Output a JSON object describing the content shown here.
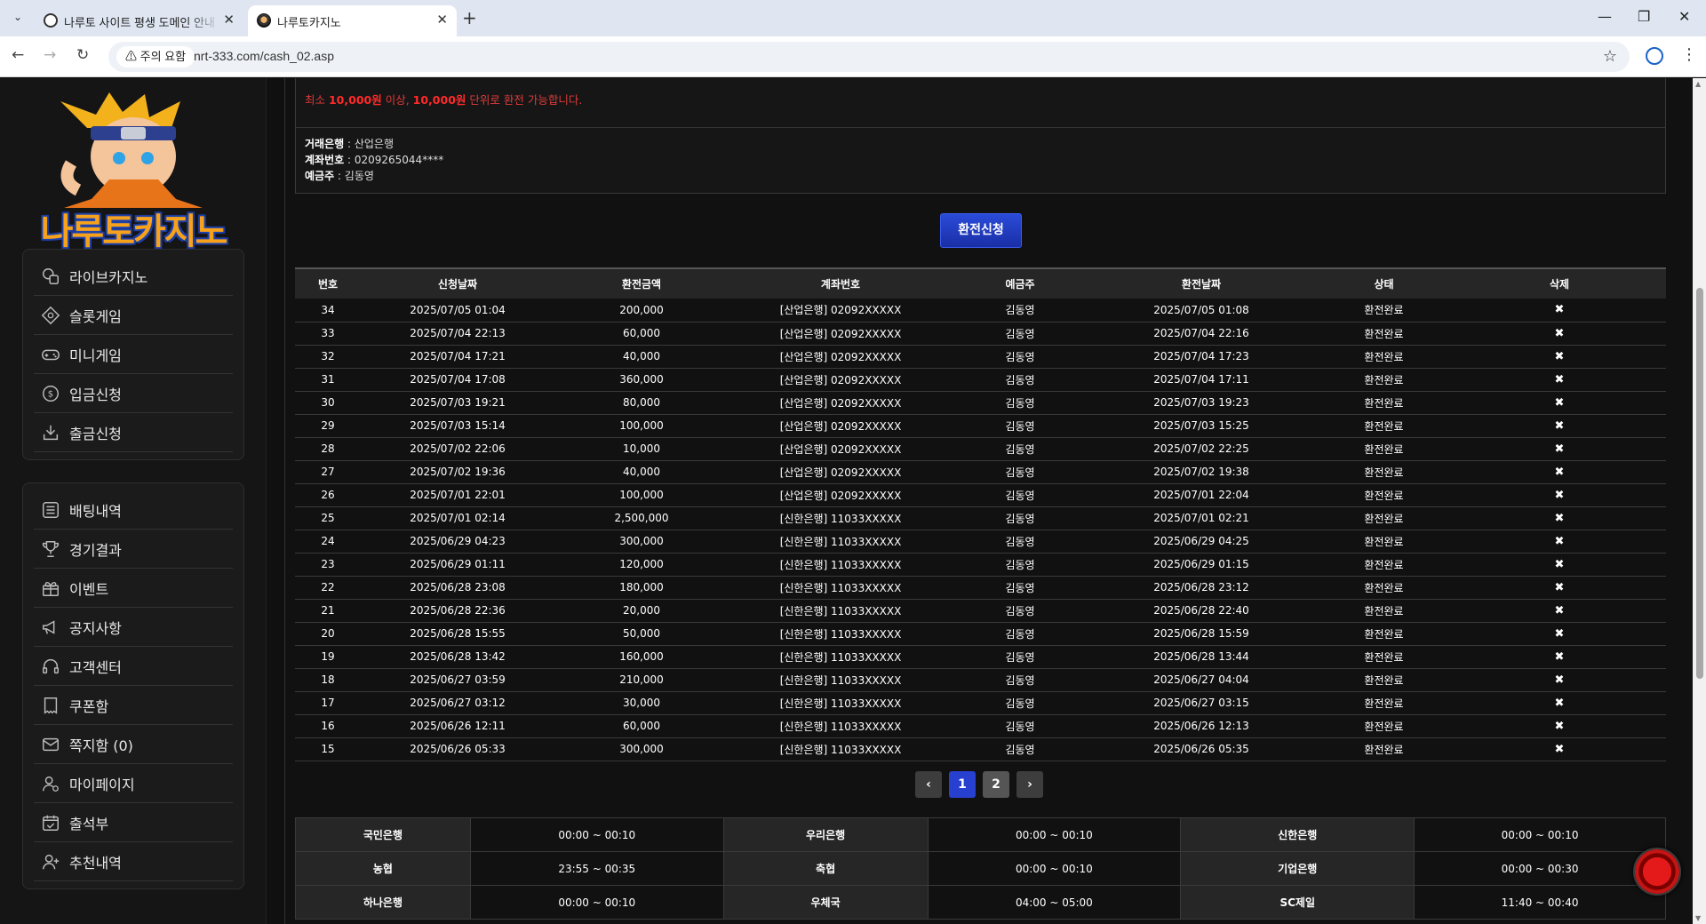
{
  "browser": {
    "tabs": [
      {
        "title": "나루토 사이트 평생 도메인 안내"
      },
      {
        "title": "나루토카지노"
      }
    ],
    "security_chip": "주의 요함",
    "url": "nrt-333.com/cash_02.asp"
  },
  "sidebar": {
    "logo_text": "나루토카지노",
    "menu_primary": [
      {
        "label": "라이브카지노",
        "icon": "casino-chips-icon"
      },
      {
        "label": "슬롯게임",
        "icon": "diamond-icon"
      },
      {
        "label": "미니게임",
        "icon": "gamepad-icon"
      },
      {
        "label": "입금신청",
        "icon": "coin-dollar-icon"
      },
      {
        "label": "출금신청",
        "icon": "download-tray-icon"
      }
    ],
    "menu_secondary": [
      {
        "label": "배팅내역",
        "icon": "list-icon"
      },
      {
        "label": "경기결과",
        "icon": "trophy-icon"
      },
      {
        "label": "이벤트",
        "icon": "gift-icon"
      },
      {
        "label": "공지사항",
        "icon": "megaphone-icon"
      },
      {
        "label": "고객센터",
        "icon": "headset-icon"
      },
      {
        "label": "쿠폰함",
        "icon": "coupon-icon"
      },
      {
        "label": "쪽지함 (0)",
        "icon": "mail-icon"
      },
      {
        "label": "마이페이지",
        "icon": "user-gear-icon"
      },
      {
        "label": "출석부",
        "icon": "calendar-check-icon"
      },
      {
        "label": "추천내역",
        "icon": "user-plus-icon"
      }
    ]
  },
  "notice": {
    "prefix": "최소 ",
    "amount1": "10,000원",
    "middle": " 이상, ",
    "amount2": "10,000원",
    "suffix": "  단위로 환전 가능합니다."
  },
  "account": {
    "bank_label": "거래은행",
    "bank_value": " : 산업은행",
    "number_label": "계좌번호",
    "number_value": " : 0209265044****",
    "holder_label": "예금주",
    "holder_value": " : 김동영"
  },
  "apply_button": "환전신청",
  "history": {
    "headers": [
      "번호",
      "신청날짜",
      "환전금액",
      "계좌번호",
      "예금주",
      "환전날짜",
      "상태",
      "삭제"
    ],
    "delete_symbol": "✖",
    "rows": [
      [
        "34",
        "2025/07/05 01:04",
        "200,000",
        "[산업은행] 02092XXXXX",
        "김동영",
        "2025/07/05 01:08",
        "환전완료"
      ],
      [
        "33",
        "2025/07/04 22:13",
        "60,000",
        "[산업은행] 02092XXXXX",
        "김동영",
        "2025/07/04 22:16",
        "환전완료"
      ],
      [
        "32",
        "2025/07/04 17:21",
        "40,000",
        "[산업은행] 02092XXXXX",
        "김동영",
        "2025/07/04 17:23",
        "환전완료"
      ],
      [
        "31",
        "2025/07/04 17:08",
        "360,000",
        "[산업은행] 02092XXXXX",
        "김동영",
        "2025/07/04 17:11",
        "환전완료"
      ],
      [
        "30",
        "2025/07/03 19:21",
        "80,000",
        "[산업은행] 02092XXXXX",
        "김동영",
        "2025/07/03 19:23",
        "환전완료"
      ],
      [
        "29",
        "2025/07/03 15:14",
        "100,000",
        "[산업은행] 02092XXXXX",
        "김동영",
        "2025/07/03 15:25",
        "환전완료"
      ],
      [
        "28",
        "2025/07/02 22:06",
        "10,000",
        "[산업은행] 02092XXXXX",
        "김동영",
        "2025/07/02 22:25",
        "환전완료"
      ],
      [
        "27",
        "2025/07/02 19:36",
        "40,000",
        "[산업은행] 02092XXXXX",
        "김동영",
        "2025/07/02 19:38",
        "환전완료"
      ],
      [
        "26",
        "2025/07/01 22:01",
        "100,000",
        "[산업은행] 02092XXXXX",
        "김동영",
        "2025/07/01 22:04",
        "환전완료"
      ],
      [
        "25",
        "2025/07/01 02:14",
        "2,500,000",
        "[신한은행] 11033XXXXX",
        "김동영",
        "2025/07/01 02:21",
        "환전완료"
      ],
      [
        "24",
        "2025/06/29 04:23",
        "300,000",
        "[신한은행] 11033XXXXX",
        "김동영",
        "2025/06/29 04:25",
        "환전완료"
      ],
      [
        "23",
        "2025/06/29 01:11",
        "120,000",
        "[신한은행] 11033XXXXX",
        "김동영",
        "2025/06/29 01:15",
        "환전완료"
      ],
      [
        "22",
        "2025/06/28 23:08",
        "180,000",
        "[신한은행] 11033XXXXX",
        "김동영",
        "2025/06/28 23:12",
        "환전완료"
      ],
      [
        "21",
        "2025/06/28 22:36",
        "20,000",
        "[신한은행] 11033XXXXX",
        "김동영",
        "2025/06/28 22:40",
        "환전완료"
      ],
      [
        "20",
        "2025/06/28 15:55",
        "50,000",
        "[신한은행] 11033XXXXX",
        "김동영",
        "2025/06/28 15:59",
        "환전완료"
      ],
      [
        "19",
        "2025/06/28 13:42",
        "160,000",
        "[신한은행] 11033XXXXX",
        "김동영",
        "2025/06/28 13:44",
        "환전완료"
      ],
      [
        "18",
        "2025/06/27 03:59",
        "210,000",
        "[신한은행] 11033XXXXX",
        "김동영",
        "2025/06/27 04:04",
        "환전완료"
      ],
      [
        "17",
        "2025/06/27 03:12",
        "30,000",
        "[신한은행] 11033XXXXX",
        "김동영",
        "2025/06/27 03:15",
        "환전완료"
      ],
      [
        "16",
        "2025/06/26 12:11",
        "60,000",
        "[신한은행] 11033XXXXX",
        "김동영",
        "2025/06/26 12:13",
        "환전완료"
      ],
      [
        "15",
        "2025/06/26 05:33",
        "300,000",
        "[신한은행] 11033XXXXX",
        "김동영",
        "2025/06/26 05:35",
        "환전완료"
      ]
    ]
  },
  "pagination": {
    "prev": "‹",
    "pages": [
      "1",
      "2"
    ],
    "current": "1",
    "next": "›"
  },
  "bank_hours": [
    [
      "국민은행",
      "00:00 ~ 00:10",
      "우리은행",
      "00:00 ~ 00:10",
      "신한은행",
      "00:00 ~ 00:10"
    ],
    [
      "농협",
      "23:55 ~ 00:35",
      "축협",
      "00:00 ~ 00:10",
      "기업은행",
      "00:00 ~ 00:30"
    ],
    [
      "하나은행",
      "00:00 ~ 00:10",
      "우체국",
      "04:00 ~ 05:00",
      "SC제일",
      "11:40 ~ 00:40"
    ]
  ]
}
